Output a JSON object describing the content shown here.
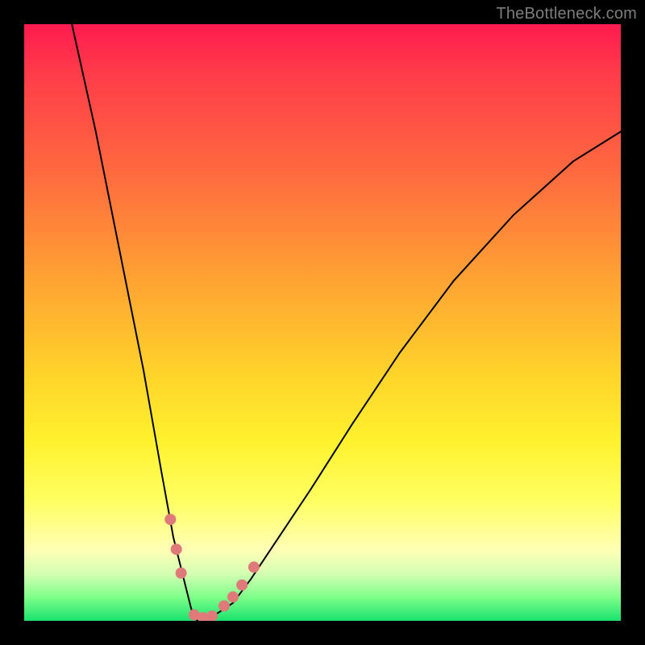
{
  "watermark": "TheBottleneck.com",
  "chart_data": {
    "type": "line",
    "title": "",
    "xlabel": "",
    "ylabel": "",
    "xlim": [
      0,
      100
    ],
    "ylim": [
      0,
      100
    ],
    "grid": false,
    "legend": false,
    "background_gradient": [
      "#ff1a4f",
      "#ffa033",
      "#fff22e",
      "#19e36e"
    ],
    "series": [
      {
        "name": "bottleneck-curve",
        "color": "#000000",
        "x": [
          8,
          12,
          16,
          20,
          23,
          25,
          27,
          28,
          29,
          30,
          32,
          35,
          38,
          42,
          48,
          55,
          63,
          72,
          82,
          92,
          100
        ],
        "values": [
          100,
          82,
          62,
          42,
          25,
          14,
          6,
          2,
          0,
          0,
          1,
          3,
          7,
          13,
          22,
          33,
          45,
          57,
          68,
          77,
          82
        ]
      }
    ],
    "markers": {
      "name": "highlighted-points",
      "color": "#e07a7a",
      "points": [
        {
          "x": 24.5,
          "y": 17
        },
        {
          "x": 25.5,
          "y": 12
        },
        {
          "x": 26.3,
          "y": 8
        },
        {
          "x": 28.5,
          "y": 1
        },
        {
          "x": 30.0,
          "y": 0.5
        },
        {
          "x": 31.5,
          "y": 0.8
        },
        {
          "x": 33.5,
          "y": 2.5
        },
        {
          "x": 35.0,
          "y": 4
        },
        {
          "x": 36.5,
          "y": 6
        },
        {
          "x": 38.5,
          "y": 9
        }
      ]
    }
  }
}
